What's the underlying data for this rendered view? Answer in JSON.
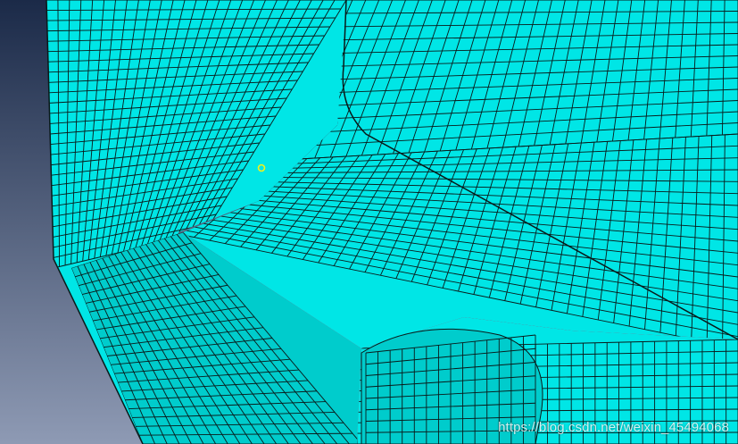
{
  "viewport": {
    "background_top_color": "#1b2a48",
    "background_bottom_color": "#8e9ab4",
    "mesh_fill_color": "#00e6e6",
    "mesh_fill_dark_color": "#00cccc",
    "mesh_line_color": "#0a1a1a",
    "pick_marker_color": "#f2f21a"
  },
  "watermark": {
    "text": "https://blog.csdn.net/weixin_45494068"
  }
}
